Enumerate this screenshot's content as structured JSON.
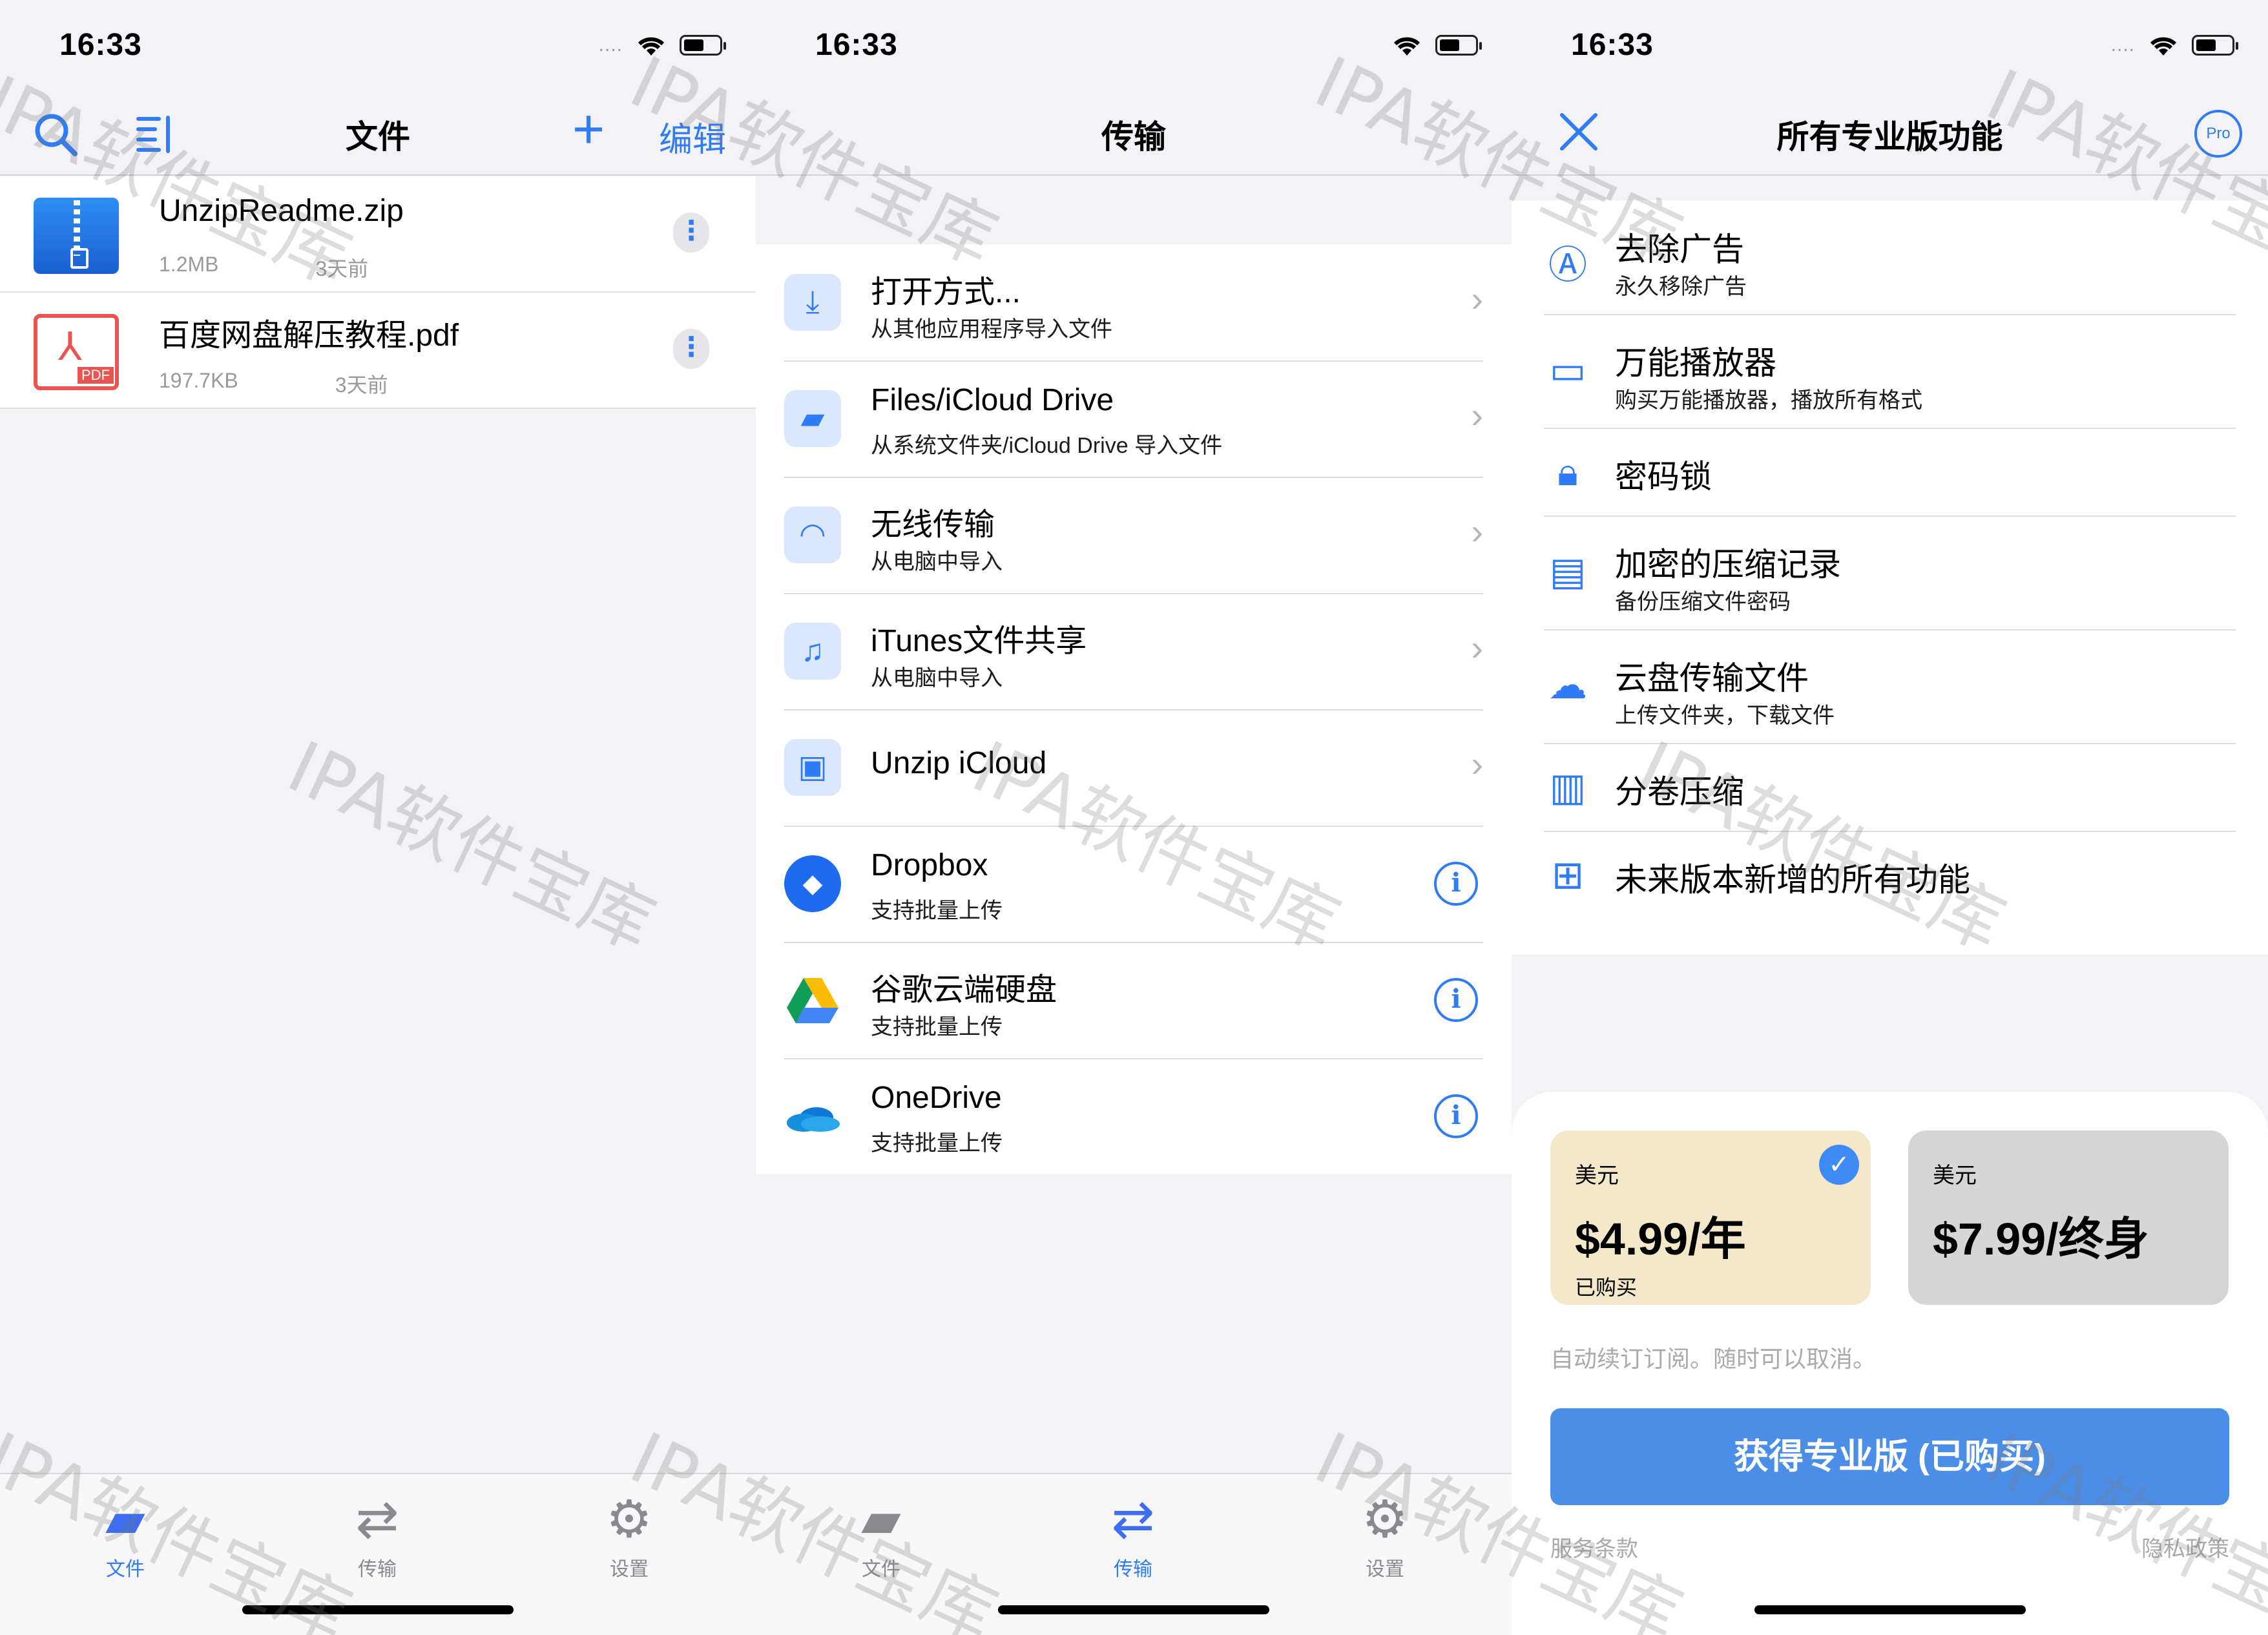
{
  "status": {
    "time": "16:33",
    "signal_dots": "....",
    "wifi": "wifi-icon",
    "battery": "battery-icon"
  },
  "files_screen": {
    "title": "文件",
    "edit_label": "编辑",
    "files": [
      {
        "name": "UnzipReadme.zip",
        "size": "1.2MB",
        "date": "3天前",
        "icon": "zip-file-icon"
      },
      {
        "name": "百度网盘解压教程.pdf",
        "size": "197.7KB",
        "date": "3天前",
        "icon": "pdf-file-icon",
        "badge": "PDF"
      }
    ]
  },
  "transfer_screen": {
    "title": "传输",
    "items": [
      {
        "title": "打开方式...",
        "subtitle": "从其他应用程序导入文件",
        "icon": "import-icon",
        "accessory": "chevron"
      },
      {
        "title": "Files/iCloud Drive",
        "subtitle": "从系统文件夹/iCloud Drive 导入文件",
        "icon": "files-folder-icon",
        "accessory": "chevron"
      },
      {
        "title": "无线传输",
        "subtitle": "从电脑中导入",
        "icon": "wifi-transfer-icon",
        "accessory": "chevron"
      },
      {
        "title": "iTunes文件共享",
        "subtitle": "从电脑中导入",
        "icon": "itunes-icon",
        "accessory": "chevron"
      },
      {
        "title": "Unzip iCloud",
        "subtitle": "",
        "icon": "unzip-icloud-icon",
        "accessory": "chevron"
      },
      {
        "title": "Dropbox",
        "subtitle": "支持批量上传",
        "icon": "dropbox-icon",
        "accessory": "info"
      },
      {
        "title": "谷歌云端硬盘",
        "subtitle": "支持批量上传",
        "icon": "google-drive-icon",
        "accessory": "info"
      },
      {
        "title": "OneDrive",
        "subtitle": "支持批量上传",
        "icon": "onedrive-icon",
        "accessory": "info"
      }
    ]
  },
  "pro_screen": {
    "title": "所有专业版功能",
    "restore_badge": "Pro",
    "features": [
      {
        "title": "去除广告",
        "subtitle": "永久移除广告",
        "icon": "no-ads-icon"
      },
      {
        "title": "万能播放器",
        "subtitle": "购买万能播放器，播放所有格式",
        "icon": "video-camera-icon"
      },
      {
        "title": "密码锁",
        "subtitle": "",
        "icon": "lock-icon"
      },
      {
        "title": "加密的压缩记录",
        "subtitle": "备份压缩文件密码",
        "icon": "encrypted-record-icon"
      },
      {
        "title": "云盘传输文件",
        "subtitle": "上传文件夹，下载文件",
        "icon": "cloud-transfer-icon"
      },
      {
        "title": "分卷压缩",
        "subtitle": "",
        "icon": "volume-split-icon"
      },
      {
        "title": "未来版本新增的所有功能",
        "subtitle": "",
        "icon": "gift-icon"
      }
    ],
    "plans": [
      {
        "currency": "美元",
        "price": "$4.99/年",
        "status": "已购买",
        "selected": true
      },
      {
        "currency": "美元",
        "price": "$7.99/终身",
        "status": "",
        "selected": false
      }
    ],
    "auto_renew_note": "自动续订订阅。随时可以取消。",
    "buy_button": "获得专业版 (已购买)",
    "terms_link": "服务条款",
    "privacy_link": "隐私政策"
  },
  "tabbar": {
    "tabs": [
      {
        "label": "文件",
        "icon": "folder-tab-icon"
      },
      {
        "label": "传输",
        "icon": "transfer-tab-icon"
      },
      {
        "label": "设置",
        "icon": "gear-tab-icon"
      }
    ]
  },
  "watermark": "IPA软件宝库",
  "colors": {
    "accent": "#2f7cf6",
    "plan_selected": "#f5e8c9",
    "plan_other": "#d6d6d6",
    "buy_button": "#4a8ee8"
  }
}
